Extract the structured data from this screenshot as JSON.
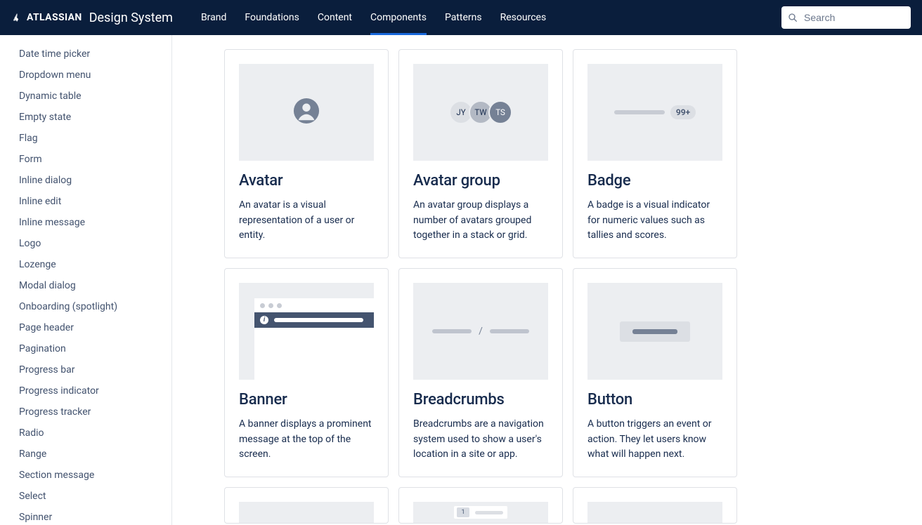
{
  "header": {
    "brand_primary": "ATLASSIAN",
    "brand_secondary": "Design System",
    "nav": [
      "Brand",
      "Foundations",
      "Content",
      "Components",
      "Patterns",
      "Resources"
    ],
    "active_nav_index": 3,
    "search_placeholder": "Search"
  },
  "sidebar": {
    "items": [
      "Date time picker",
      "Dropdown menu",
      "Dynamic table",
      "Empty state",
      "Flag",
      "Form",
      "Inline dialog",
      "Inline edit",
      "Inline message",
      "Logo",
      "Lozenge",
      "Modal dialog",
      "Onboarding (spotlight)",
      "Page header",
      "Pagination",
      "Progress bar",
      "Progress indicator",
      "Progress tracker",
      "Radio",
      "Range",
      "Section message",
      "Select",
      "Spinner"
    ]
  },
  "cards": [
    {
      "id": "avatar",
      "title": "Avatar",
      "desc": "An avatar is a visual representation of a user or entity."
    },
    {
      "id": "avatar-group",
      "title": "Avatar group",
      "desc": "An avatar group displays a number of avatars grouped together in a stack or grid.",
      "initials": [
        "JY",
        "TW",
        "TS"
      ]
    },
    {
      "id": "badge",
      "title": "Badge",
      "desc": "A badge is a visual indicator for numeric values such as tallies and scores.",
      "badge_text": "99+"
    },
    {
      "id": "banner",
      "title": "Banner",
      "desc": "A banner displays a prominent message at the top of the screen."
    },
    {
      "id": "breadcrumbs",
      "title": "Breadcrumbs",
      "desc": "Breadcrumbs are a navigation system used to show a user's location in a site or app.",
      "separator": "/"
    },
    {
      "id": "button",
      "title": "Button",
      "desc": "A button triggers an event or action. They let users know what will happen next."
    }
  ],
  "partial_cards": [
    {
      "id": "p1"
    },
    {
      "id": "calendar",
      "date_num": "1"
    },
    {
      "id": "p3"
    }
  ]
}
